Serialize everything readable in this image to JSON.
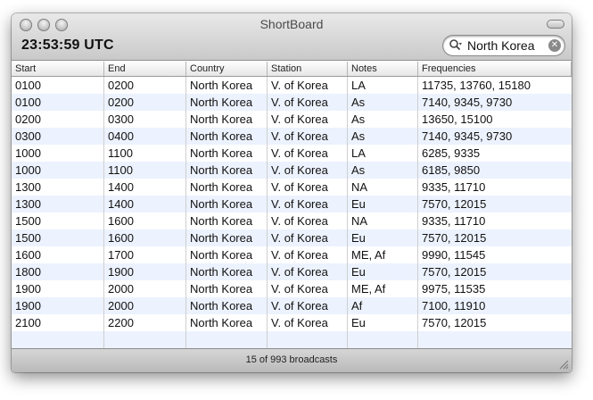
{
  "window": {
    "title": "ShortBoard",
    "clock": "23:53:59 UTC"
  },
  "search": {
    "value": "North Korea",
    "icon": "search-icon",
    "clear_icon": "clear-search-icon"
  },
  "table": {
    "columns": [
      "Start",
      "End",
      "Country",
      "Station",
      "Notes",
      "Frequencies"
    ],
    "rows": [
      [
        "0100",
        "0200",
        "North Korea",
        "V. of Korea",
        "LA",
        "11735, 13760, 15180"
      ],
      [
        "0100",
        "0200",
        "North Korea",
        "V. of Korea",
        "As",
        "7140, 9345, 9730"
      ],
      [
        "0200",
        "0300",
        "North Korea",
        "V. of Korea",
        "As",
        "13650, 15100"
      ],
      [
        "0300",
        "0400",
        "North Korea",
        "V. of Korea",
        "As",
        "7140, 9345, 9730"
      ],
      [
        "1000",
        "1100",
        "North Korea",
        "V. of Korea",
        "LA",
        "6285, 9335"
      ],
      [
        "1000",
        "1100",
        "North Korea",
        "V. of Korea",
        "As",
        "6185, 9850"
      ],
      [
        "1300",
        "1400",
        "North Korea",
        "V. of Korea",
        "NA",
        "9335, 11710"
      ],
      [
        "1300",
        "1400",
        "North Korea",
        "V. of Korea",
        "Eu",
        "7570, 12015"
      ],
      [
        "1500",
        "1600",
        "North Korea",
        "V. of Korea",
        "NA",
        "9335, 11710"
      ],
      [
        "1500",
        "1600",
        "North Korea",
        "V. of Korea",
        "Eu",
        "7570, 12015"
      ],
      [
        "1600",
        "1700",
        "North Korea",
        "V. of Korea",
        "ME, Af",
        "9990, 11545"
      ],
      [
        "1800",
        "1900",
        "North Korea",
        "V. of Korea",
        "Eu",
        "7570, 12015"
      ],
      [
        "1900",
        "2000",
        "North Korea",
        "V. of Korea",
        "ME, Af",
        "9975, 11535"
      ],
      [
        "1900",
        "2000",
        "North Korea",
        "V. of Korea",
        "Af",
        "7100, 11910"
      ],
      [
        "2100",
        "2200",
        "North Korea",
        "V. of Korea",
        "Eu",
        "7570, 12015"
      ]
    ]
  },
  "status": {
    "text": "15 of 993 broadcasts"
  },
  "colors": {
    "row_alt": "#edf3fe",
    "chrome": "#c9c9c9"
  }
}
